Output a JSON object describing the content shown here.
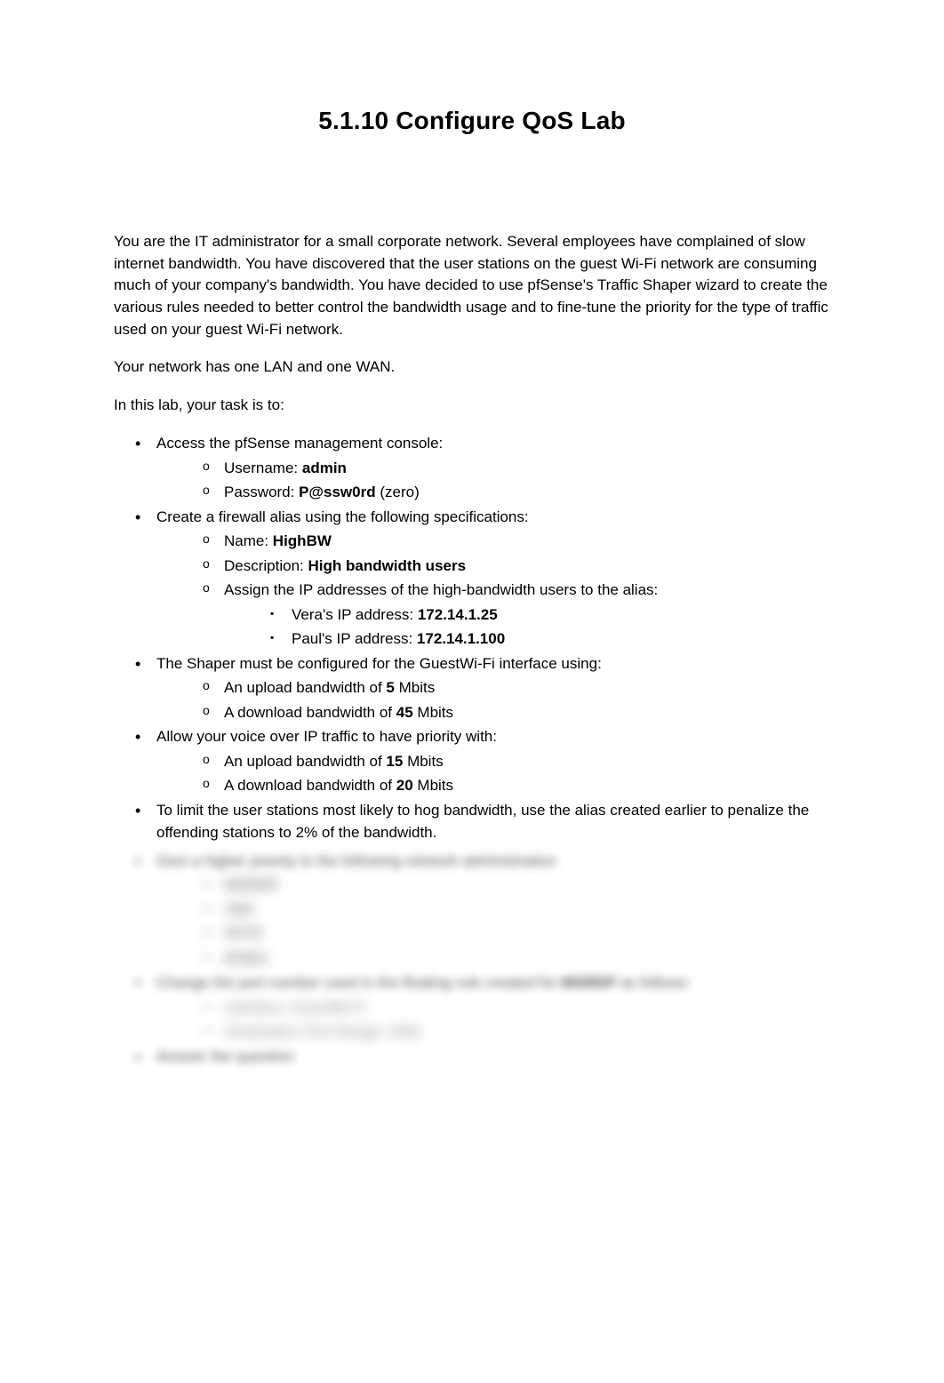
{
  "title": "5.1.10 Configure QoS Lab",
  "intro": "You are the IT administrator for a small corporate network. Several employees have complained of slow internet bandwidth. You have discovered that the user stations on the guest Wi-Fi network are consuming much of your company's bandwidth. You have decided to use pfSense's Traffic Shaper wizard to create the various rules needed to better control the bandwidth usage and to fine-tune the priority for the type of traffic used on your guest Wi-Fi network.",
  "network_line": "Your network has one LAN and one WAN.",
  "task_line": "In this lab, your task is to:",
  "li": {
    "access": "Access the pfSense management console:",
    "username_label": "Username: ",
    "username_value": "admin",
    "password_label": "Password: ",
    "password_value": "P@ssw0rd",
    "password_suffix": " (zero)",
    "firewall_alias": "Create a firewall alias using the following specifications:",
    "name_label": "Name: ",
    "name_value": "HighBW",
    "desc_label": "Description: ",
    "desc_value": "High bandwidth users",
    "assign_ips": "Assign the IP addresses of the high-bandwidth users to the alias:",
    "vera_label": "Vera's IP address: ",
    "vera_value": "172.14.1.25",
    "paul_label": "Paul's IP address: ",
    "paul_value": "172.14.1.100",
    "shaper": "The Shaper must be configured for the GuestWi-Fi interface using:",
    "upload_pre": "An upload bandwidth of ",
    "upload_val": "5",
    "upload_suf": " Mbits",
    "download_pre": "A download bandwidth of ",
    "download_val": "45",
    "download_suf": " Mbits",
    "voip": "Allow your voice over IP traffic to have priority with:",
    "voip_up_pre": "An upload bandwidth of ",
    "voip_up_val": "15",
    "voip_up_suf": " Mbits",
    "voip_dn_pre": "A download bandwidth of ",
    "voip_dn_val": "20",
    "voip_dn_suf": " Mbits",
    "penalize": "To limit the user stations most likely to hog bandwidth, use the alias created earlier to penalize the offending stations to 2% of the bandwidth."
  },
  "blurred": {
    "b1": "Give a higher priority to the following network administration",
    "b1a": "MSRDP",
    "b1b": "VNC",
    "b1c": "PPTP",
    "b1d": "IPSEC",
    "b2_pre": "Change the port number used in the floating rule created for ",
    "b2_strong": "MSRDP",
    "b2_suf": " as follows:",
    "b2a": "Interface: GuestWi-Fi",
    "b2b": "Destination Port Range: 3391",
    "b3": "Answer the question."
  }
}
